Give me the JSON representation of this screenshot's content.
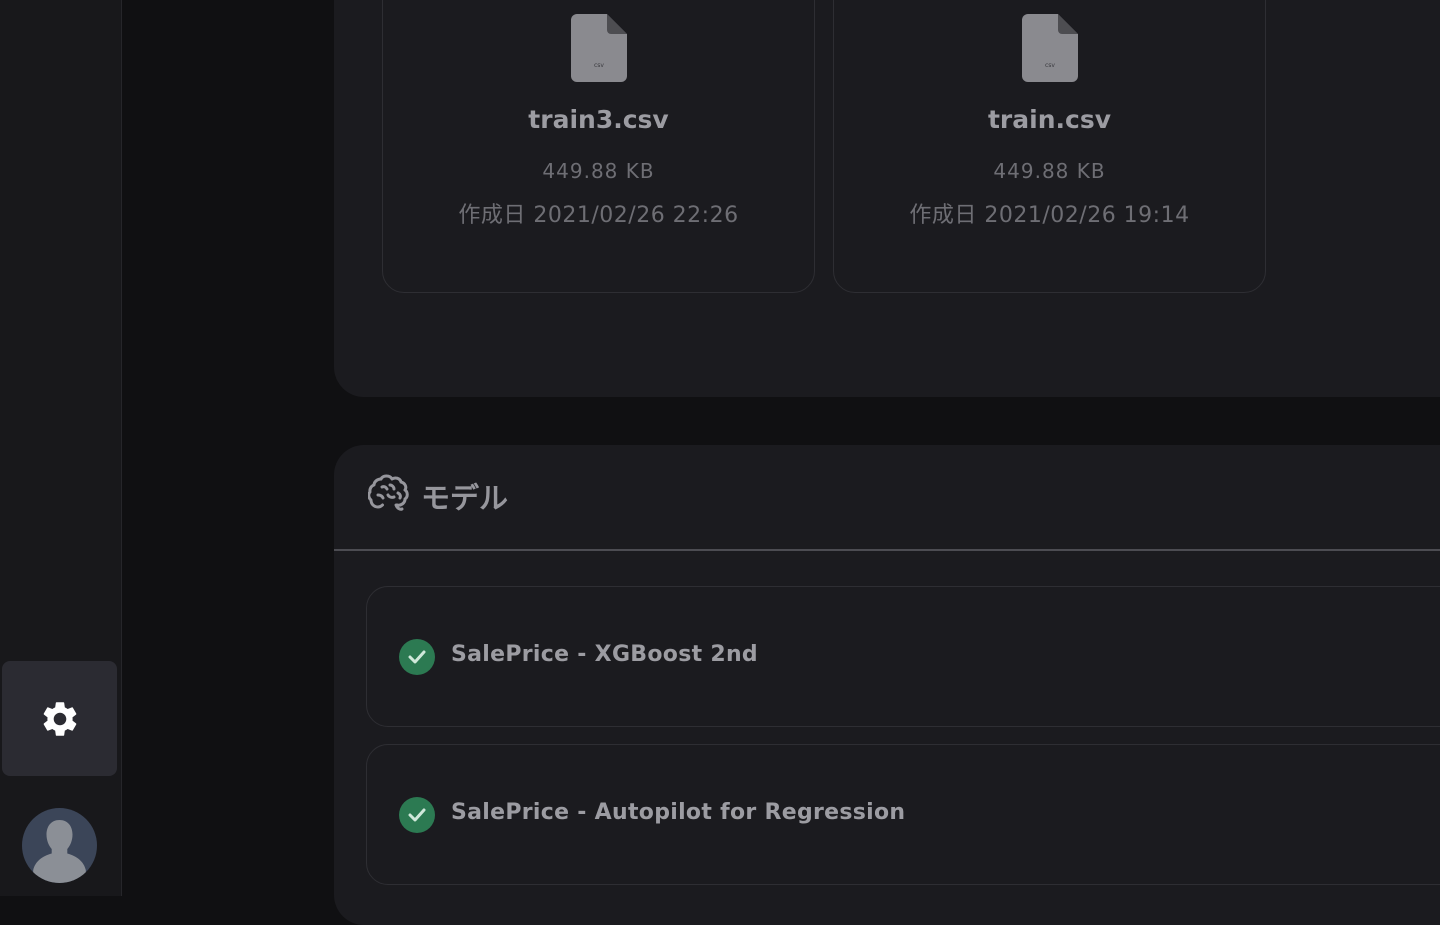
{
  "sidebar": {
    "settings_icon": "gear-icon",
    "avatar_icon": "user-silhouette-icon"
  },
  "files": [
    {
      "name": "train3.csv",
      "size": "449.88 KB",
      "created": "作成日 2021/02/26 22:26",
      "icon": "csv-file-icon",
      "icon_label": "csv"
    },
    {
      "name": "train.csv",
      "size": "449.88 KB",
      "created": "作成日 2021/02/26 19:14",
      "icon": "csv-file-icon",
      "icon_label": "csv"
    }
  ],
  "models": {
    "title": "モデル",
    "icon": "brain-icon",
    "items": [
      {
        "name": "SalePrice - XGBoost 2nd",
        "status_icon": "check-circle-icon"
      },
      {
        "name": "SalePrice - Autopilot for Regression",
        "status_icon": "check-circle-icon"
      }
    ]
  },
  "colors": {
    "background": "#101012",
    "panel": "#1b1b1f",
    "success": "#2c7a52"
  }
}
